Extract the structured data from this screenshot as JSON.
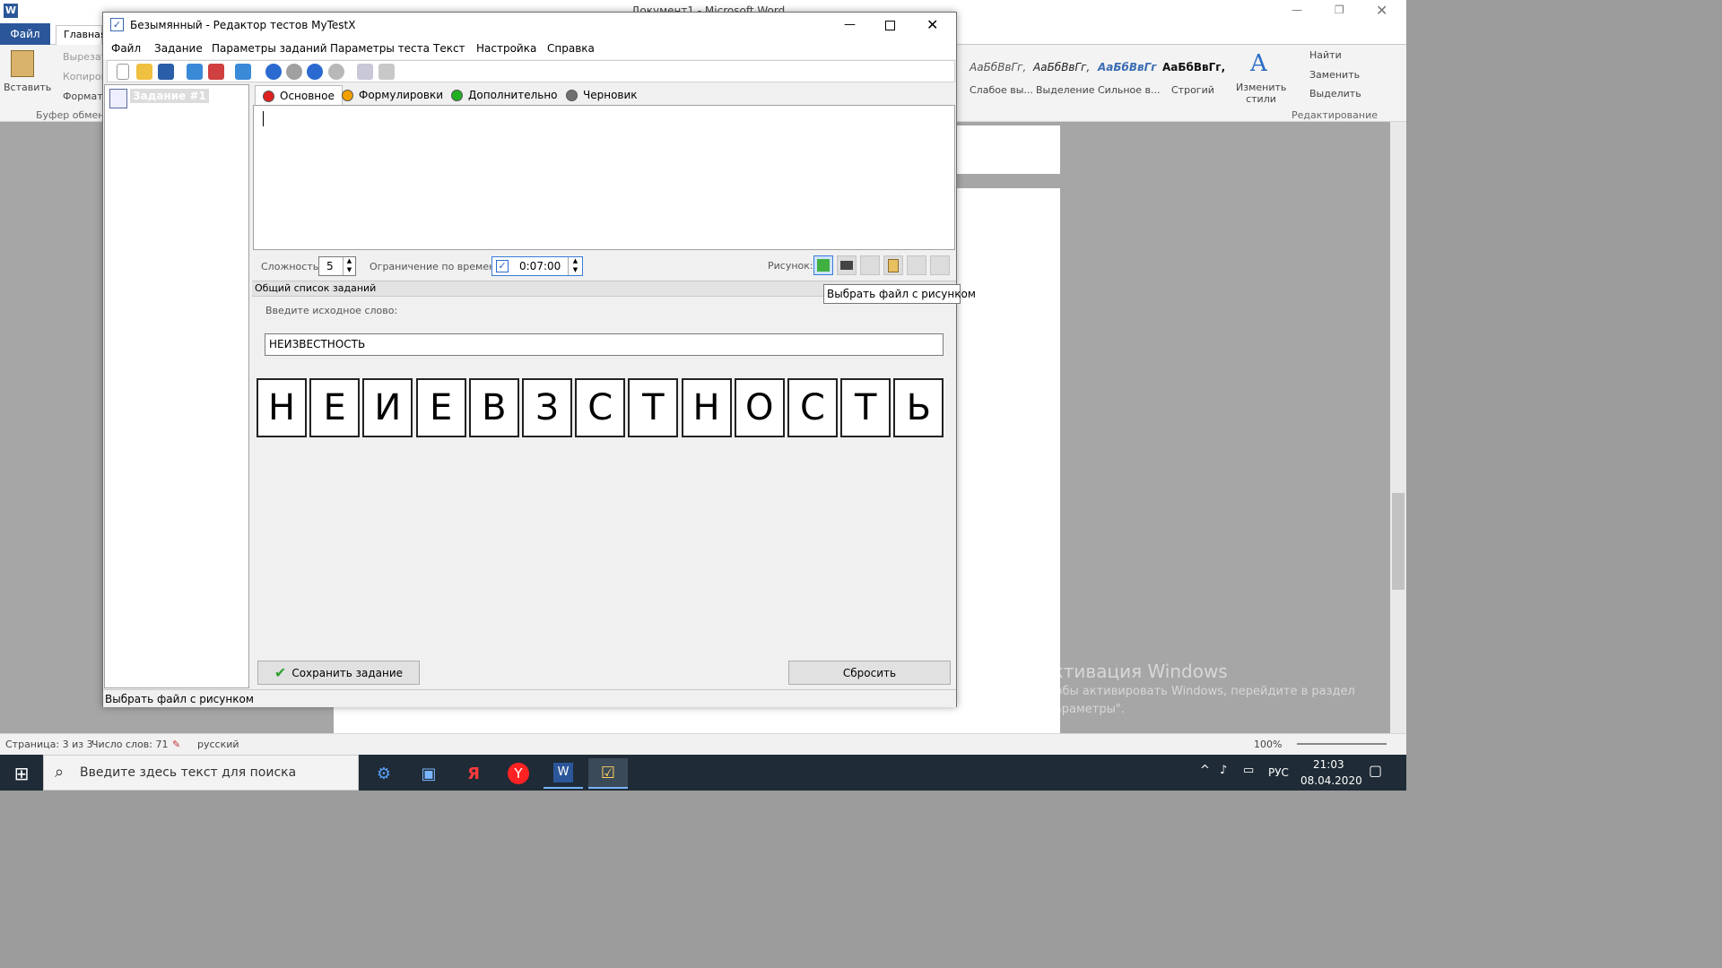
{
  "word": {
    "title": "Документ1 - Microsoft Word",
    "tab_file": "Файл",
    "tab_home": "Главная",
    "clipboard": {
      "paste": "Вставить",
      "cut": "Вырезать",
      "copy": "Копиров",
      "format": "Формат п",
      "group": "Буфер обмена"
    },
    "styles": [
      {
        "sample": "АаБбВвГг,",
        "name": "Слабое вы..."
      },
      {
        "sample": "АаБбВвГг,",
        "name": "Выделение"
      },
      {
        "sample": "АаБбВвГг",
        "name": "Сильное в..."
      },
      {
        "sample": "АаБбВвГг,",
        "name": "Строгий"
      }
    ],
    "change_styles": "Изменить стили",
    "editing": {
      "find": "Найти",
      "replace": "Заменить",
      "select": "Выделить",
      "group": "Редактирование"
    },
    "status": {
      "page": "Страница: 3 из 3",
      "words": "Число слов: 71",
      "language": "русский",
      "zoom": "100%"
    },
    "activation": {
      "title": "Активация Windows",
      "line1": "Чтобы активировать Windows, перейдите в раздел",
      "line2": "\"Параметры\"."
    }
  },
  "taskbar": {
    "search_placeholder": "Введите здесь текст для поиска",
    "lang": "РУС",
    "time": "21:03",
    "date": "08.04.2020"
  },
  "app": {
    "title": "Безымянный - Редактор тестов MyTestX",
    "menu": [
      "Файл",
      "Задание",
      "Параметры заданий",
      "Параметры теста",
      "Текст",
      "Настройка",
      "Справка"
    ],
    "tree_item": "Задание #1",
    "tabs": [
      {
        "label": "Основное",
        "color": "#e02020"
      },
      {
        "label": "Формулировки",
        "color": "#f0a000"
      },
      {
        "label": "Дополнительно",
        "color": "#20b020"
      },
      {
        "label": "Черновик",
        "color": "#707070"
      }
    ],
    "difficulty_label": "Сложность:",
    "difficulty_value": "5",
    "time_limit_label": "Ограничение по времени:",
    "time_limit_value": "0:07:00",
    "picture_label": "Рисунок:",
    "list_header": "Общий список заданий",
    "word_prompt": "Введите исходное слово:",
    "source_word": "НЕИЗВЕСТНОСТЬ",
    "letters": [
      "Н",
      "Е",
      "И",
      "Е",
      "В",
      "З",
      "С",
      "Т",
      "Н",
      "О",
      "С",
      "Т",
      "Ь"
    ],
    "save_button": "Сохранить задание",
    "reset_button": "Сбросить",
    "status_text": "Выбрать файл с рисунком",
    "tooltip": "Выбрать файл с рисунком"
  },
  "colors": {
    "word_blue": "#2b579a",
    "taskbar": "#1f2b36"
  }
}
